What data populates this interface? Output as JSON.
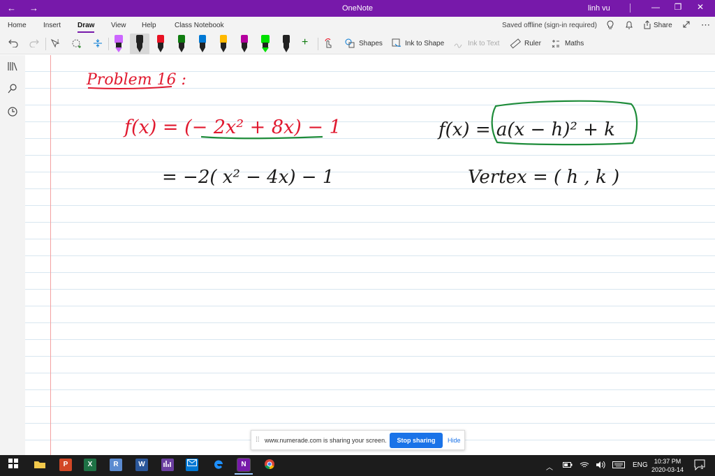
{
  "titlebar": {
    "back_glyph": "←",
    "forward_glyph": "→",
    "title": "OneNote",
    "user": "linh vu",
    "minimize_glyph": "—",
    "maximize_glyph": "❐",
    "close_glyph": "✕",
    "background_color": "#7719aa"
  },
  "ribbon_tabs": [
    {
      "label": "Home"
    },
    {
      "label": "Insert"
    },
    {
      "label": "Draw",
      "active": true
    },
    {
      "label": "View"
    },
    {
      "label": "Help"
    },
    {
      "label": "Class Notebook"
    }
  ],
  "ribbon_right": {
    "status": "Saved offline (sign-in required)",
    "share": "Share",
    "more_glyph": "⋯"
  },
  "toolbar": {
    "undo_icon": "undo-icon",
    "redo_icon": "redo-icon",
    "lasso_icon": "lasso-select-icon",
    "eraser_icon": "eraser-icon",
    "insert_space_icon": "insert-space-icon",
    "pens": [
      {
        "cap_color": "#cc66ff",
        "type": "highlighter"
      },
      {
        "cap_color": "#222222",
        "type": "pen",
        "selected": true
      },
      {
        "cap_color": "#e81123",
        "type": "pen"
      },
      {
        "cap_color": "#107c10",
        "type": "pen"
      },
      {
        "cap_color": "#0078d4",
        "type": "pen"
      },
      {
        "cap_color": "#ffb900",
        "type": "pen"
      },
      {
        "cap_color": "#b4009e",
        "type": "pen"
      },
      {
        "cap_color": "#00e000",
        "type": "highlighter"
      },
      {
        "cap_color": "#222222",
        "type": "pencil"
      }
    ],
    "add_pen_glyph": "+",
    "shapes": "Shapes",
    "ink_to_shape": "Ink to Shape",
    "ink_to_text": "Ink to Text",
    "ruler": "Ruler",
    "maths": "Maths"
  },
  "ink": {
    "problem_heading": "Problem 16 :",
    "line1": "f(x) = (− 2x² + 8x) − 1",
    "line2": "= −2( x² − 4x) − 1",
    "vertex_form": "f(x) = a(x − h)² + k",
    "vertex": "Vertex = ( h , k )",
    "colors": {
      "red": "#e0192f",
      "black": "#1a1a1a",
      "green": "#1e8c3a"
    }
  },
  "share_bar": {
    "message": "www.numerade.com is sharing your screen.",
    "stop_button": "Stop sharing",
    "hide_button": "Hide"
  },
  "taskbar": {
    "apps": [
      {
        "name": "start-icon"
      },
      {
        "name": "file-explorer-icon"
      },
      {
        "name": "powerpoint-icon",
        "letter": "P",
        "color": "#d24726"
      },
      {
        "name": "excel-icon",
        "letter": "X",
        "color": "#1e7145"
      },
      {
        "name": "r-icon",
        "letter": "R",
        "color": "#5b8bd0"
      },
      {
        "name": "word-icon",
        "letter": "W",
        "color": "#2b579a"
      },
      {
        "name": "stats-app-icon",
        "letter": "",
        "color": "#6b3fa0"
      },
      {
        "name": "mail-icon",
        "letter": "",
        "color": "#0078d4"
      },
      {
        "name": "edge-icon",
        "letter": "e",
        "color": "#1c1c1c"
      },
      {
        "name": "onenote-icon",
        "letter": "N",
        "color": "#7719aa",
        "active": true
      },
      {
        "name": "chrome-icon",
        "letter": "",
        "color": "#1c1c1c"
      }
    ],
    "language": "ENG",
    "time": "10:37 PM",
    "date": "2020-03-14",
    "notifications": "1"
  }
}
